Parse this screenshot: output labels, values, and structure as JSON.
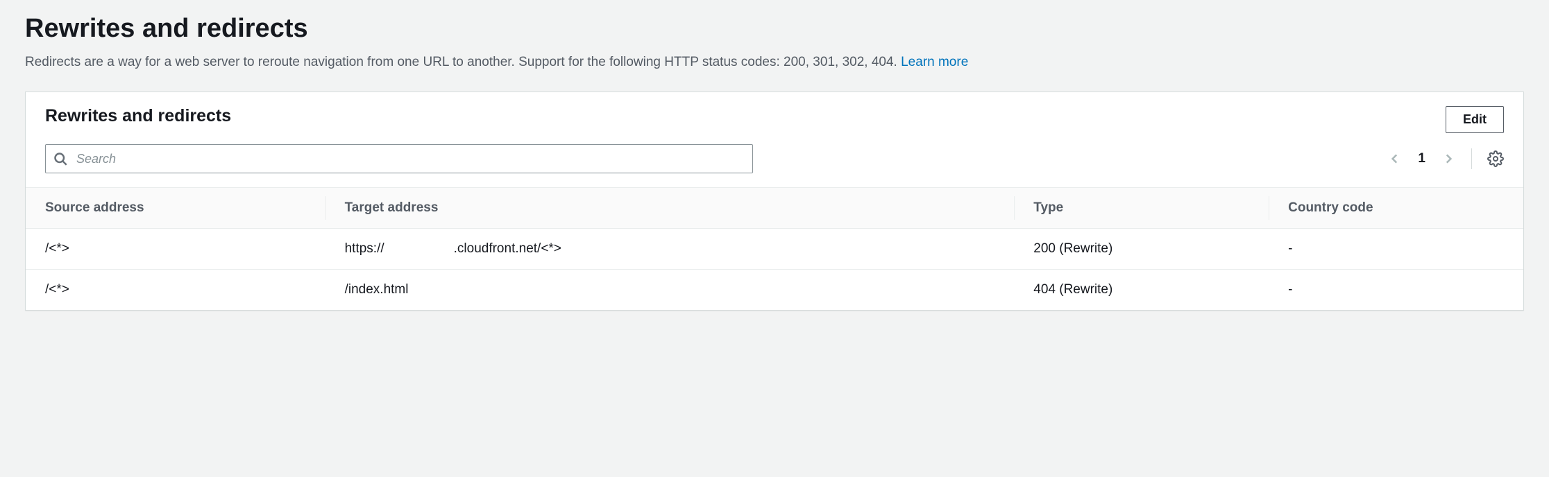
{
  "page": {
    "title": "Rewrites and redirects",
    "description": "Redirects are a way for a web server to reroute navigation from one URL to another. Support for the following HTTP status codes: 200, 301, 302, 404. ",
    "learn_more": "Learn more"
  },
  "panel": {
    "title": "Rewrites and redirects",
    "edit_label": "Edit",
    "search_placeholder": "Search",
    "page_number": "1"
  },
  "table": {
    "columns": {
      "source": "Source address",
      "target": "Target address",
      "type": "Type",
      "country": "Country code"
    },
    "rows": [
      {
        "source": "/<*>",
        "target_prefix": "https://",
        "target_suffix": ".cloudfront.net/<*>",
        "type": "200 (Rewrite)",
        "country": "-"
      },
      {
        "source": "/<*>",
        "target_prefix": "/index.html",
        "target_suffix": "",
        "type": "404 (Rewrite)",
        "country": "-"
      }
    ]
  }
}
